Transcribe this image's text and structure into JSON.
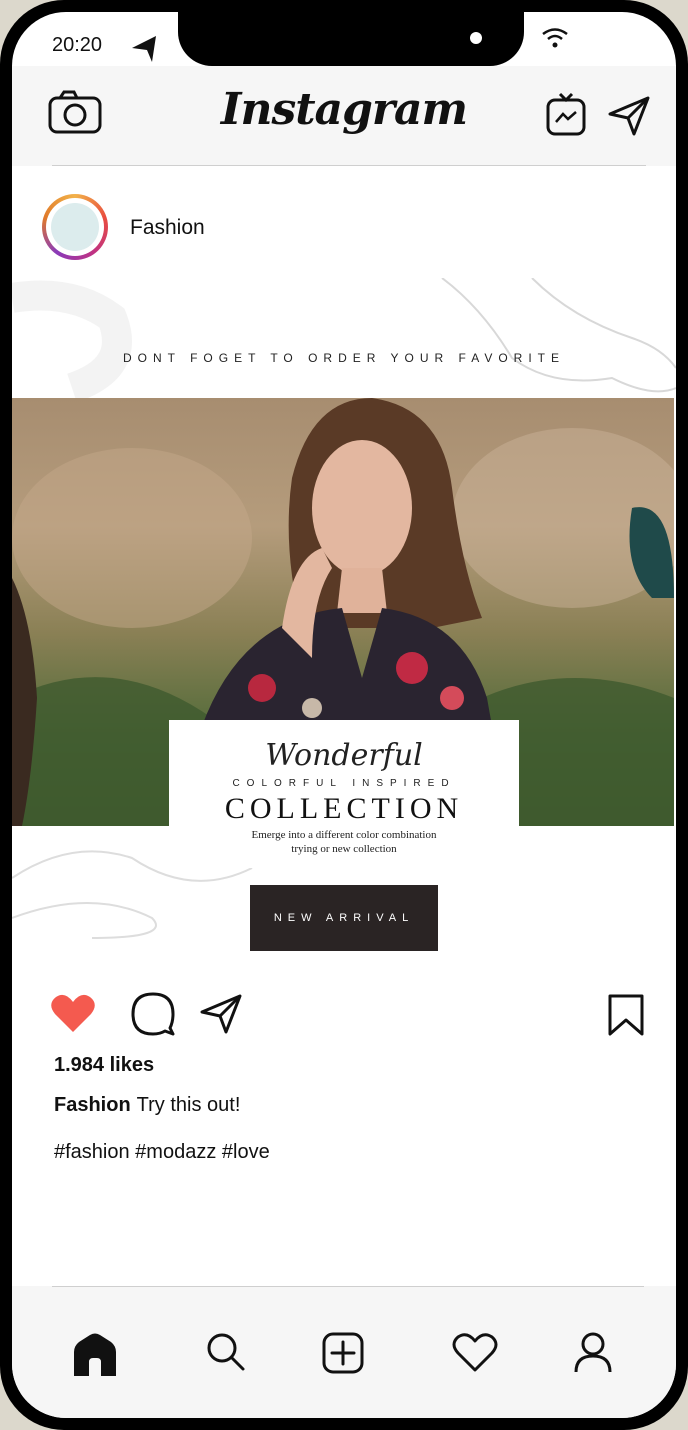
{
  "status": {
    "time": "20:20"
  },
  "header": {
    "logo": "Instagram"
  },
  "post": {
    "username": "Fashion",
    "tagline": "DONT FOGET TO ORDER YOUR FAVORITE",
    "script_title": "Wonderful",
    "subtitle": "COLORFUL INSPIRED",
    "title": "COLLECTION",
    "description_line1": "Emerge into a different color combination",
    "description_line2": "trying or new collection",
    "cta": "NEW ARRIVAL",
    "likes": "1.984 likes",
    "caption_user": "Fashion",
    "caption_text": "Try this out!",
    "hashtags": "#fashion #modazz #love"
  },
  "colors": {
    "like": "#f45a4f",
    "cta_bg": "#2a2424"
  },
  "icons": {
    "top": [
      "camera-icon",
      "igtv-icon",
      "direct-message-icon"
    ],
    "actions": [
      "heart-filled-icon",
      "comment-icon",
      "share-icon",
      "bookmark-icon"
    ],
    "tabs": [
      "home-icon",
      "search-icon",
      "add-post-icon",
      "activity-heart-icon",
      "profile-icon"
    ]
  }
}
